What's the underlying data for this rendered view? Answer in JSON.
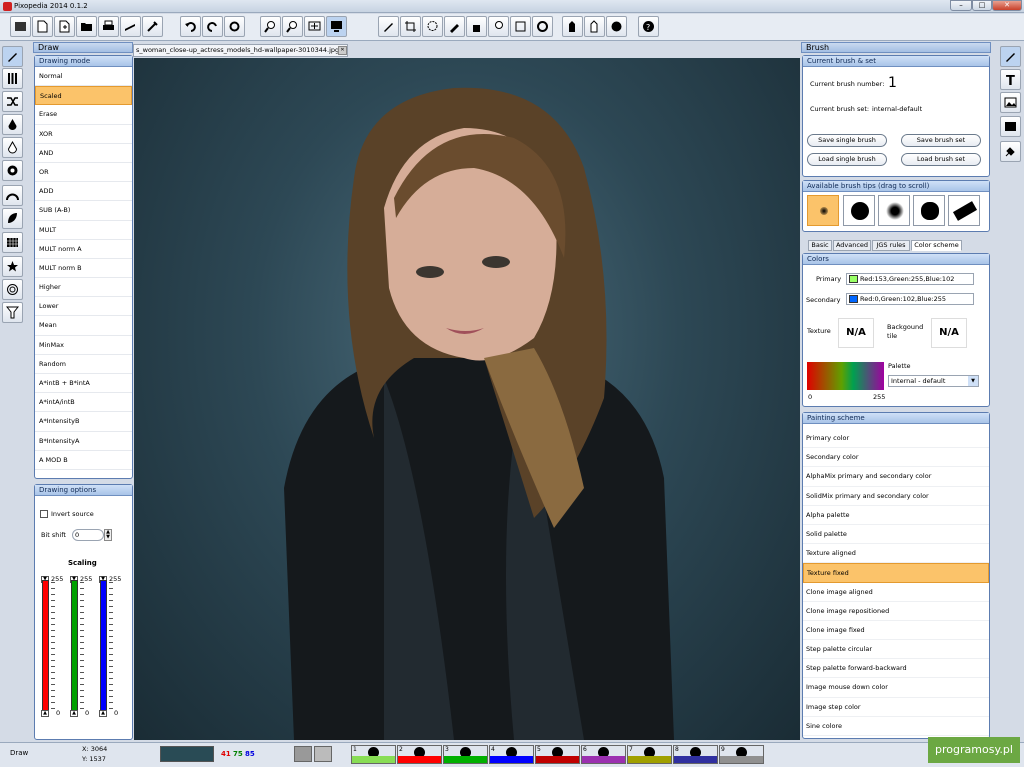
{
  "app": {
    "title": "Pixopedia 2014 0.1.2",
    "min": "–",
    "max": "□",
    "close": "✕"
  },
  "left_dock": {
    "title": "Draw",
    "drawing_mode": {
      "title": "Drawing mode",
      "modes": [
        "Normal",
        "Scaled",
        "Erase",
        "XOR",
        "AND",
        "OR",
        "ADD",
        "SUB (A-B)",
        "MULT",
        "MULT norm A",
        "MULT norm B",
        "Higher",
        "Lower",
        "Mean",
        "MinMax",
        "Random",
        "A*intB + B*intA",
        "A*intA/intB",
        "A*IntensityB",
        "B*IntensityA",
        "A MOD B"
      ],
      "selected": "Scaled"
    },
    "drawing_options": {
      "title": "Drawing options",
      "invert_source": "Invert source",
      "bit_shift_label": "Bit shift",
      "bit_shift_value": "0",
      "scaling_label": "Scaling",
      "channels": [
        {
          "max": "255",
          "min": "0",
          "color": "#ff0000"
        },
        {
          "max": "255",
          "min": "0",
          "color": "#00a000"
        },
        {
          "max": "255",
          "min": "0",
          "color": "#0000ff"
        }
      ]
    }
  },
  "document": {
    "tab_label": "s_woman_close-up_actress_models_hd-wallpaper-3010344.jpg",
    "tab_close": "✕"
  },
  "right_dock": {
    "title": "Brush",
    "current_brush": {
      "title": "Current brush & set",
      "number_label": "Current brush number:",
      "number": "1",
      "set_label": "Current brush set:",
      "set_value": "internal-default",
      "buttons": [
        "Save single brush",
        "Save brush set",
        "Load single brush",
        "Load brush set"
      ]
    },
    "tips": {
      "title": "Available brush tips (drag to scroll)"
    },
    "tabs": [
      "Basic",
      "Advanced",
      "JGS rules",
      "Color scheme"
    ],
    "active_tab": "Color scheme",
    "colors": {
      "title": "Colors",
      "primary_label": "Primary",
      "primary_value": "Red:153,Green:255,Blue:102",
      "primary_color": "#99ff66",
      "secondary_label": "Secondary",
      "secondary_value": "Red:0,Green:102,Blue:255",
      "secondary_color": "#0066ff",
      "texture_label": "Texture",
      "texture_value": "N/A",
      "background_tile_label": "Backgound tile",
      "background_tile_value": "N/A",
      "palette_label": "Palette",
      "palette_value": "Internal - default",
      "palette_min": "0",
      "palette_max": "255"
    },
    "painting_scheme": {
      "title": "Painting scheme",
      "items": [
        "Primary color",
        "Secondary color",
        "AlphaMix primary and secondary color",
        "SolidMix primary and secondary color",
        "Alpha palette",
        "Solid palette",
        "Texture aligned",
        "Texture fixed",
        "Clone image aligned",
        "Clone image repositioned",
        "Clone image fixed",
        "Step palette circular",
        "Step palette forward-backward",
        "Image mouse down color",
        "Image step color",
        "Sine colore"
      ],
      "selected": "Texture fixed"
    }
  },
  "status": {
    "mode": "Draw",
    "x": "X: 3064",
    "y": "Y: 1537",
    "r": "41",
    "g": "75",
    "b": "85",
    "swatches": [
      {
        "n": "1",
        "color": "#88dd55"
      },
      {
        "n": "2",
        "color": "#ff0000"
      },
      {
        "n": "3",
        "color": "#00b000"
      },
      {
        "n": "4",
        "color": "#0000ff"
      },
      {
        "n": "5",
        "color": "#c00000"
      },
      {
        "n": "6",
        "color": "#9b30b0"
      },
      {
        "n": "7",
        "color": "#a0a000"
      },
      {
        "n": "8",
        "color": "#3030a0"
      },
      {
        "n": "9",
        "color": "#909090"
      }
    ],
    "watermark": "programosy.pl"
  }
}
